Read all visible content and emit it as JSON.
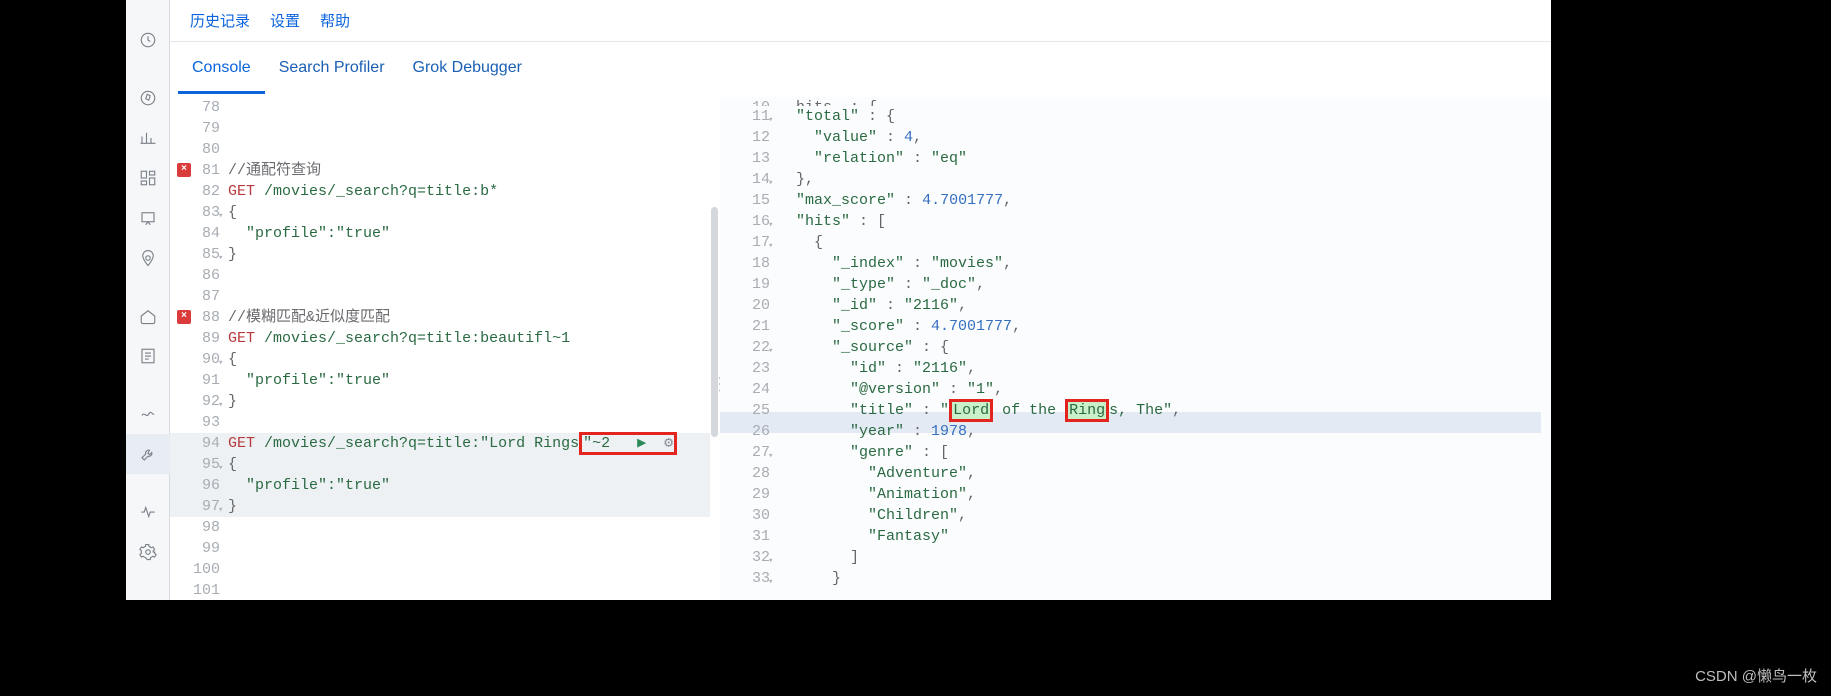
{
  "topbar": {
    "history": "历史记录",
    "settings": "设置",
    "help": "帮助"
  },
  "tabs": {
    "console": "Console",
    "search_profiler": "Search Profiler",
    "grok_debugger": "Grok Debugger"
  },
  "left_editor": {
    "lines": [
      {
        "n": "78"
      },
      {
        "n": "79"
      },
      {
        "n": "80"
      },
      {
        "n": "81",
        "err": true,
        "comment": "//通配符查询"
      },
      {
        "n": "82",
        "method": "GET",
        "path": "/movies/_search?q=title:b*"
      },
      {
        "n": "83",
        "fold": true,
        "open": "{"
      },
      {
        "n": "84",
        "kv": "  \"profile\":\"true\""
      },
      {
        "n": "85",
        "fold": true,
        "close": "}"
      },
      {
        "n": "86"
      },
      {
        "n": "87"
      },
      {
        "n": "88",
        "err": true,
        "comment": "//模糊匹配&近似度匹配"
      },
      {
        "n": "89",
        "method": "GET",
        "path": "/movies/_search?q=title:beautifl~1"
      },
      {
        "n": "90",
        "fold": true,
        "open": "{"
      },
      {
        "n": "91",
        "kv": "  \"profile\":\"true\""
      },
      {
        "n": "92",
        "fold": true,
        "close": "}"
      },
      {
        "n": "93"
      },
      {
        "n": "94",
        "method": "GET",
        "path_pre": "/movies/_search?q=title:\"Lord Rings",
        "path_boxed": "\"~2",
        "has_actions": true
      },
      {
        "n": "95",
        "fold": true,
        "open": "{"
      },
      {
        "n": "96",
        "kv": "  \"profile\":\"true\""
      },
      {
        "n": "97",
        "fold": true,
        "close": "}"
      },
      {
        "n": "98"
      },
      {
        "n": "99"
      },
      {
        "n": "100"
      },
      {
        "n": "101"
      }
    ]
  },
  "right_editor": {
    "first_partial": {
      "n": "10",
      "text": "hits  : {"
    },
    "lines": [
      {
        "n": "11",
        "fold": true,
        "body": [
          {
            "s": "  "
          },
          {
            "k": "\"total\""
          },
          {
            "s": " : {"
          }
        ]
      },
      {
        "n": "12",
        "body": [
          {
            "s": "    "
          },
          {
            "k": "\"value\""
          },
          {
            "s": " : "
          },
          {
            "num": "4"
          },
          {
            "s": ","
          }
        ]
      },
      {
        "n": "13",
        "body": [
          {
            "s": "    "
          },
          {
            "k": "\"relation\""
          },
          {
            "s": " : "
          },
          {
            "v": "\"eq\""
          }
        ]
      },
      {
        "n": "14",
        "fold": true,
        "body": [
          {
            "s": "  },"
          }
        ]
      },
      {
        "n": "15",
        "body": [
          {
            "s": "  "
          },
          {
            "k": "\"max_score\""
          },
          {
            "s": " : "
          },
          {
            "num": "4.7001777"
          },
          {
            "s": ","
          }
        ]
      },
      {
        "n": "16",
        "fold": true,
        "body": [
          {
            "s": "  "
          },
          {
            "k": "\"hits\""
          },
          {
            "s": " : ["
          }
        ]
      },
      {
        "n": "17",
        "fold": true,
        "body": [
          {
            "s": "    {"
          }
        ]
      },
      {
        "n": "18",
        "body": [
          {
            "s": "      "
          },
          {
            "k": "\"_index\""
          },
          {
            "s": " : "
          },
          {
            "v": "\"movies\""
          },
          {
            "s": ","
          }
        ]
      },
      {
        "n": "19",
        "body": [
          {
            "s": "      "
          },
          {
            "k": "\"_type\""
          },
          {
            "s": " : "
          },
          {
            "v": "\"_doc\""
          },
          {
            "s": ","
          }
        ]
      },
      {
        "n": "20",
        "body": [
          {
            "s": "      "
          },
          {
            "k": "\"_id\""
          },
          {
            "s": " : "
          },
          {
            "v": "\"2116\""
          },
          {
            "s": ","
          }
        ]
      },
      {
        "n": "21",
        "body": [
          {
            "s": "      "
          },
          {
            "k": "\"_score\""
          },
          {
            "s": " : "
          },
          {
            "num": "4.7001777"
          },
          {
            "s": ","
          }
        ]
      },
      {
        "n": "22",
        "fold": true,
        "body": [
          {
            "s": "      "
          },
          {
            "k": "\"_source\""
          },
          {
            "s": " : {"
          }
        ]
      },
      {
        "n": "23",
        "body": [
          {
            "s": "        "
          },
          {
            "k": "\"id\""
          },
          {
            "s": " : "
          },
          {
            "v": "\"2116\""
          },
          {
            "s": ","
          }
        ]
      },
      {
        "n": "24",
        "body": [
          {
            "s": "        "
          },
          {
            "k": "\"@version\""
          },
          {
            "s": " : "
          },
          {
            "v": "\"1\""
          },
          {
            "s": ","
          }
        ]
      },
      {
        "n": "25",
        "highlight": true,
        "title_line": true
      },
      {
        "n": "26",
        "body": [
          {
            "s": "        "
          },
          {
            "k": "\"year\""
          },
          {
            "s": " : "
          },
          {
            "num": "1978"
          },
          {
            "s": ","
          }
        ]
      },
      {
        "n": "27",
        "fold": true,
        "body": [
          {
            "s": "        "
          },
          {
            "k": "\"genre\""
          },
          {
            "s": " : ["
          }
        ]
      },
      {
        "n": "28",
        "body": [
          {
            "s": "          "
          },
          {
            "v": "\"Adventure\""
          },
          {
            "s": ","
          }
        ]
      },
      {
        "n": "29",
        "body": [
          {
            "s": "          "
          },
          {
            "v": "\"Animation\""
          },
          {
            "s": ","
          }
        ]
      },
      {
        "n": "30",
        "body": [
          {
            "s": "          "
          },
          {
            "v": "\"Children\""
          },
          {
            "s": ","
          }
        ]
      },
      {
        "n": "31",
        "body": [
          {
            "s": "          "
          },
          {
            "v": "\"Fantasy\""
          }
        ]
      },
      {
        "n": "32",
        "fold": true,
        "body": [
          {
            "s": "        ]"
          }
        ]
      },
      {
        "n": "33",
        "fold": true,
        "body": [
          {
            "s": "      }"
          }
        ]
      }
    ],
    "title_parts": {
      "prefix_key": "\"title\"",
      "sep": " : ",
      "q1": "\"",
      "lord": "Lord",
      "mid": " of the ",
      "ring": "Ring",
      "tail": "s, The\"",
      "comma": ","
    }
  },
  "watermark": "CSDN @懒鸟一枚"
}
